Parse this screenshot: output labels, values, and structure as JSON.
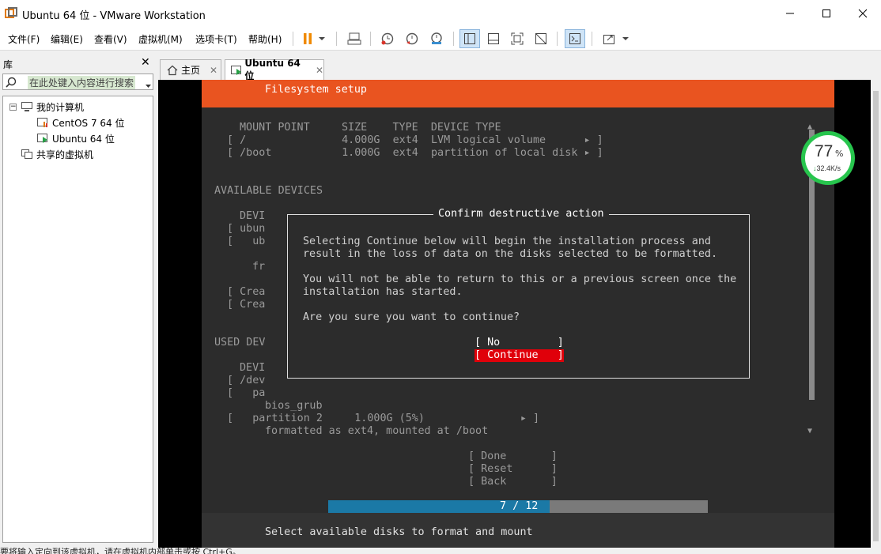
{
  "window": {
    "title": "Ubuntu 64 位 - VMware Workstation"
  },
  "menu": [
    "文件(F)",
    "编辑(E)",
    "查看(V)",
    "虚拟机(M)",
    "选项卡(T)",
    "帮助(H)"
  ],
  "toolbar": {
    "icons": [
      "pause-icon",
      "dropdown-icon",
      "send-keys-icon",
      "snapshot-icon",
      "revert-snapshot-icon",
      "snapshot-manager-icon",
      "library-view-icon",
      "thumbnail-view-icon",
      "fullscreen-icon",
      "unity-icon",
      "console-view-icon",
      "stretch-icon"
    ]
  },
  "library": {
    "title": "库",
    "search_placeholder": "在此处键入内容进行搜索",
    "root": "我的计算机",
    "vms": [
      "CentOS 7 64 位",
      "Ubuntu 64 位"
    ],
    "shared": "共享的虚拟机"
  },
  "tabs": [
    {
      "label": "主页",
      "active": false
    },
    {
      "label": "Ubuntu 64 位",
      "active": true
    }
  ],
  "installer": {
    "header": "Filesystem setup",
    "fs_table": {
      "headers": "MOUNT POINT     SIZE    TYPE  DEVICE TYPE",
      "rows": [
        "[ /               4.000G  ext4  LVM logical volume      ▸ ]",
        "[ /boot           1.000G  ext4  partition of local disk ▸ ]"
      ]
    },
    "available_devices": "AVAILABLE DEVICES",
    "avail_lines": [
      "DEVI",
      "[ ubun",
      "[   ub",
      "fr",
      "[ Crea",
      "[ Crea"
    ],
    "used_devices": "USED DEV",
    "used_lines": [
      "DEVI",
      "[ /dev",
      "[   pa",
      "bios_grub"
    ],
    "used_partition": "[   partition 2     1.000G (5%)               ▸ ]",
    "used_formatted": "formatted as ext4, mounted at /boot",
    "actions": [
      "[ Done       ]",
      "[ Reset      ]",
      "[ Back       ]"
    ],
    "progress": {
      "text": "7 / 12",
      "current": 7,
      "total": 12
    },
    "footer": "Select available disks to format and mount"
  },
  "dialog": {
    "title": "Confirm destructive action",
    "line1": "Selecting Continue below will begin the installation process and",
    "line2": "result in the loss of data on the disks selected to be formatted.",
    "line3": "You will not be able to return to this or a previous screen once the",
    "line4": "installation has started.",
    "question": "Are you sure you want to continue?",
    "no_label": "[ No         ]",
    "continue_label": "[ Continue   ]"
  },
  "net_widget": {
    "percent": "77",
    "percent_sym": "%",
    "speed": "32.4K/s",
    "color": "#27c54d"
  },
  "status": {
    "text": "要将输入定向到该虚拟机，请在虚拟机内部单击或按 Ctrl+G。"
  },
  "colors": {
    "ubuntu_orange": "#e95420",
    "continue_red": "#e0000a",
    "progress_blue": "#1b79a6"
  }
}
